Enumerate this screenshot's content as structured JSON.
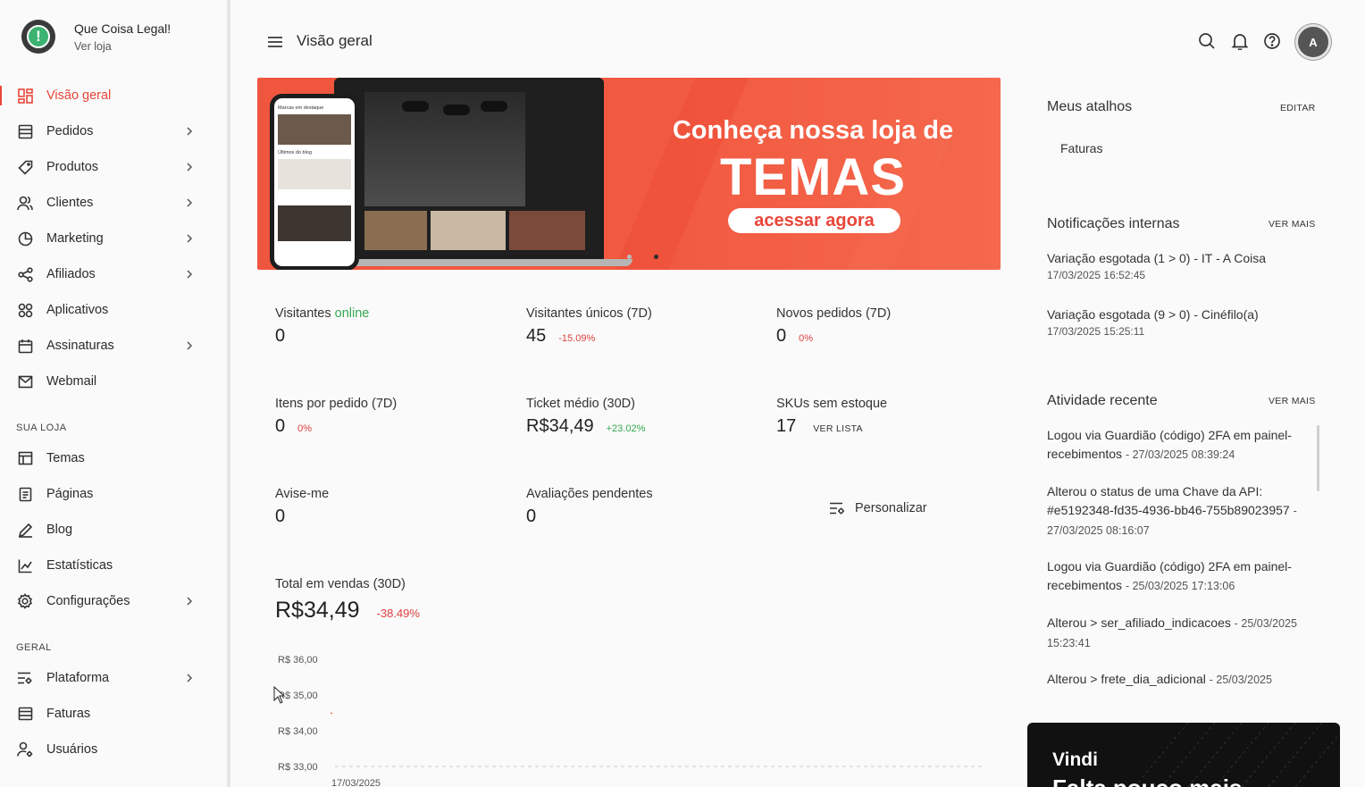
{
  "store": {
    "name": "Que Coisa Legal!",
    "link": "Ver loja",
    "logo_glyph": "!"
  },
  "nav": {
    "main": [
      {
        "label": "Visão geral",
        "icon": "dashboard-icon",
        "active": true
      },
      {
        "label": "Pedidos",
        "icon": "orders-icon",
        "chevron": true
      },
      {
        "label": "Produtos",
        "icon": "tag-icon",
        "chevron": true
      },
      {
        "label": "Clientes",
        "icon": "users-icon",
        "chevron": true
      },
      {
        "label": "Marketing",
        "icon": "pie-icon",
        "chevron": true
      },
      {
        "label": "Afiliados",
        "icon": "share-icon",
        "chevron": true
      },
      {
        "label": "Aplicativos",
        "icon": "apps-icon"
      },
      {
        "label": "Assinaturas",
        "icon": "calendar-icon",
        "chevron": true
      },
      {
        "label": "Webmail",
        "icon": "mail-icon"
      }
    ],
    "section_store": "SUA LOJA",
    "store_items": [
      {
        "label": "Temas",
        "icon": "layout-icon"
      },
      {
        "label": "Páginas",
        "icon": "page-icon"
      },
      {
        "label": "Blog",
        "icon": "pen-icon"
      },
      {
        "label": "Estatísticas",
        "icon": "chart-icon"
      },
      {
        "label": "Configurações",
        "icon": "gear-icon",
        "chevron": true
      }
    ],
    "section_general": "GERAL",
    "general_items": [
      {
        "label": "Plataforma",
        "icon": "sliders-icon",
        "chevron": true
      },
      {
        "label": "Faturas",
        "icon": "invoice-icon"
      },
      {
        "label": "Usuários",
        "icon": "user-settings-icon"
      }
    ]
  },
  "topbar": {
    "title": "Visão geral",
    "avatar_letter": "A"
  },
  "banner": {
    "headline": "Conheça nossa loja de",
    "big": "TEMAS",
    "cta": "acessar agora",
    "phone_heading": "Marcas em destaque",
    "phone_blog": "Últimos do blog"
  },
  "stats": {
    "visitors_label": "Visitantes ",
    "visitors_online": "online",
    "visitors_value": "0",
    "unique_label": "Visitantes únicos (7D)",
    "unique_value": "45",
    "unique_delta": "-15.09%",
    "orders_label": "Novos pedidos (7D)",
    "orders_value": "0",
    "orders_delta": "0%",
    "items_label": "Itens por pedido (7D)",
    "items_value": "0",
    "items_delta": "0%",
    "ticket_label": "Ticket médio (30D)",
    "ticket_value": "R$34,49",
    "ticket_delta": "+23.02%",
    "skus_label": "SKUs sem estoque",
    "skus_value": "17",
    "skus_link": "VER LISTA",
    "avise_label": "Avise-me",
    "avise_value": "0",
    "reviews_label": "Avaliações pendentes",
    "reviews_value": "0",
    "customize": "Personalizar",
    "total_label": "Total em vendas (30D)",
    "total_value": "R$34,49",
    "total_delta": "-38.49%"
  },
  "chart_data": {
    "type": "line",
    "x": [
      "17/03/2025"
    ],
    "series": [
      {
        "values": [
          34.49
        ]
      }
    ],
    "y_ticks": [
      "R$ 36,00",
      "R$ 35,00",
      "R$ 34,00",
      "R$ 33,00"
    ],
    "x_ticks": [
      "17/03/2025"
    ],
    "ylim": [
      33,
      36
    ]
  },
  "shortcuts": {
    "title": "Meus atalhos",
    "action": "EDITAR",
    "items": [
      "Faturas"
    ]
  },
  "notifications": {
    "title": "Notificações internas",
    "action": "VER MAIS",
    "items": [
      {
        "text": "Variação esgotada (1 > 0) - IT - A Coisa",
        "time": "17/03/2025 16:52:45"
      },
      {
        "text": "Variação esgotada (9 > 0) - Cinéfilo(a)",
        "time": "17/03/2025 15:25:11"
      }
    ]
  },
  "activity": {
    "title": "Atividade recente",
    "action": "VER MAIS",
    "items": [
      {
        "text": "Logou via Guardião (código) 2FA em painel-recebimentos",
        "time": "27/03/2025 08:39:24"
      },
      {
        "text": "Alterou o status de uma Chave da API: #e5192348-fd35-4936-bb46-755b89023957",
        "time": "27/03/2025 08:16:07"
      },
      {
        "text": "Logou via Guardião (código) 2FA em painel-recebimentos",
        "time": "25/03/2025 17:13:06"
      },
      {
        "text": "Alterou > ser_afiliado_indicacoes",
        "time": "25/03/2025 15:23:41"
      },
      {
        "text": "Alterou > frete_dia_adicional",
        "time": "25/03/2025"
      }
    ]
  },
  "promo": {
    "title": "Vindi",
    "subtitle": "Falta pouco mais"
  },
  "colors": {
    "accent": "#e8463a",
    "banner": "#f15a41",
    "positive": "#35a853",
    "negative": "#e04040"
  }
}
